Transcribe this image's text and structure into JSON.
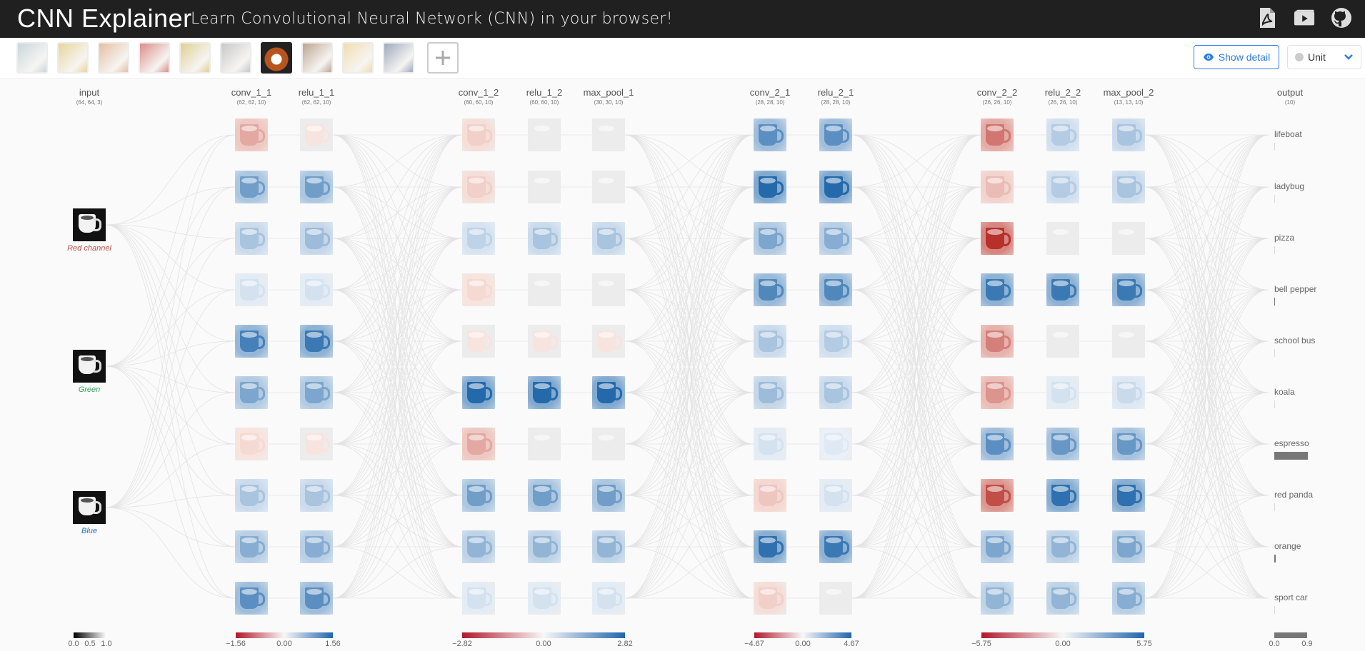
{
  "header": {
    "title": "CNN Explainer",
    "subtitle": "Learn Convolutional Neural Network (CNN) in your browser!",
    "icons": [
      "pdf-icon",
      "video-icon",
      "github-icon"
    ]
  },
  "toolbar": {
    "thumbnails": [
      {
        "name": "boat-thumb",
        "color": "#9fb5c0"
      },
      {
        "name": "ladybug-thumb",
        "color": "#d8b34a"
      },
      {
        "name": "pizza-thumb",
        "color": "#d28a55"
      },
      {
        "name": "bell-pepper-thumb",
        "color": "#c0302a"
      },
      {
        "name": "school-bus-thumb",
        "color": "#c9a93a"
      },
      {
        "name": "koala-thumb",
        "color": "#9a9a9a"
      },
      {
        "name": "espresso-thumb",
        "color": "#b8541d",
        "selected": true
      },
      {
        "name": "red-panda-thumb",
        "color": "#8c5a3a"
      },
      {
        "name": "orange-thumb",
        "color": "#e8c070"
      },
      {
        "name": "sport-car-thumb",
        "color": "#50648a"
      }
    ],
    "add_label": "+",
    "show_detail_label": "Show detail",
    "unit_label": "Unit"
  },
  "layers": [
    {
      "name": "input",
      "shape": "(64, 64, 3)"
    },
    {
      "name": "conv_1_1",
      "shape": "(62, 62, 10)"
    },
    {
      "name": "relu_1_1",
      "shape": "(62, 62, 10)"
    },
    {
      "name": "conv_1_2",
      "shape": "(60, 60, 10)"
    },
    {
      "name": "relu_1_2",
      "shape": "(60, 60, 10)"
    },
    {
      "name": "max_pool_1",
      "shape": "(30, 30, 10)"
    },
    {
      "name": "conv_2_1",
      "shape": "(28, 28, 10)"
    },
    {
      "name": "relu_2_1",
      "shape": "(28, 28, 10)"
    },
    {
      "name": "conv_2_2",
      "shape": "(26, 26, 10)"
    },
    {
      "name": "relu_2_2",
      "shape": "(26, 26, 10)"
    },
    {
      "name": "max_pool_2",
      "shape": "(13, 13, 10)"
    },
    {
      "name": "output",
      "shape": "(10)"
    }
  ],
  "channels": [
    {
      "label": "Red channel",
      "color": "#c0504d"
    },
    {
      "label": "Green",
      "color": "#3aa35a"
    },
    {
      "label": "Blue",
      "color": "#2c6fbb"
    }
  ],
  "outputs": [
    {
      "label": "lifeboat",
      "prob": 0.0
    },
    {
      "label": "ladybug",
      "prob": 0.0
    },
    {
      "label": "pizza",
      "prob": 0.0
    },
    {
      "label": "bell pepper",
      "prob": 0.02
    },
    {
      "label": "school bus",
      "prob": 0.0
    },
    {
      "label": "koala",
      "prob": 0.0
    },
    {
      "label": "espresso",
      "prob": 0.9
    },
    {
      "label": "red panda",
      "prob": 0.0
    },
    {
      "label": "orange",
      "prob": 0.04
    },
    {
      "label": "sport car",
      "prob": 0.0
    }
  ],
  "colorbars": [
    {
      "min": "0.0",
      "mid": "0.5",
      "max": "1.0",
      "type": "gray"
    },
    {
      "min": "−1.56",
      "mid": "0.00",
      "max": "1.56",
      "type": "diverging"
    },
    {
      "min": "−2.82",
      "mid": "0.00",
      "max": "2.82",
      "type": "diverging"
    },
    {
      "min": "−4.67",
      "mid": "0.00",
      "max": "4.67",
      "type": "diverging"
    },
    {
      "min": "−5.75",
      "mid": "0.00",
      "max": "5.75",
      "type": "diverging"
    },
    {
      "min": "0.0",
      "max": "0.9",
      "type": "gray"
    }
  ],
  "activations": [
    [
      0.35,
      -0.6,
      -0.35,
      -0.15,
      -0.8,
      -0.55,
      0.1,
      -0.35,
      -0.5,
      -0.7
    ],
    [
      0.05,
      -0.6,
      -0.4,
      -0.15,
      -0.85,
      -0.55,
      0.05,
      -0.35,
      -0.5,
      -0.7
    ],
    [
      0.15,
      0.15,
      -0.25,
      0.1,
      0.05,
      -0.95,
      0.35,
      -0.6,
      -0.45,
      -0.15
    ],
    [
      0.02,
      0.02,
      -0.35,
      0.02,
      0.05,
      -0.95,
      0.02,
      -0.6,
      -0.45,
      -0.15
    ],
    [
      0.02,
      0.02,
      -0.35,
      0.02,
      0.05,
      -0.95,
      0.02,
      -0.6,
      -0.45,
      -0.15
    ],
    [
      -0.7,
      -0.95,
      -0.55,
      -0.75,
      -0.35,
      -0.4,
      -0.15,
      0.2,
      -0.9,
      0.15
    ],
    [
      -0.7,
      -0.95,
      -0.5,
      -0.75,
      -0.3,
      -0.35,
      -0.1,
      -0.15,
      -0.85,
      0.02
    ],
    [
      0.6,
      0.25,
      0.95,
      -0.85,
      0.55,
      0.45,
      -0.7,
      0.8,
      -0.55,
      -0.45
    ],
    [
      -0.3,
      -0.3,
      0.02,
      -0.85,
      0.02,
      -0.15,
      -0.65,
      -0.9,
      -0.45,
      -0.45
    ],
    [
      -0.35,
      -0.35,
      0.02,
      -0.85,
      0.02,
      -0.2,
      -0.65,
      -0.9,
      -0.55,
      -0.5
    ]
  ]
}
